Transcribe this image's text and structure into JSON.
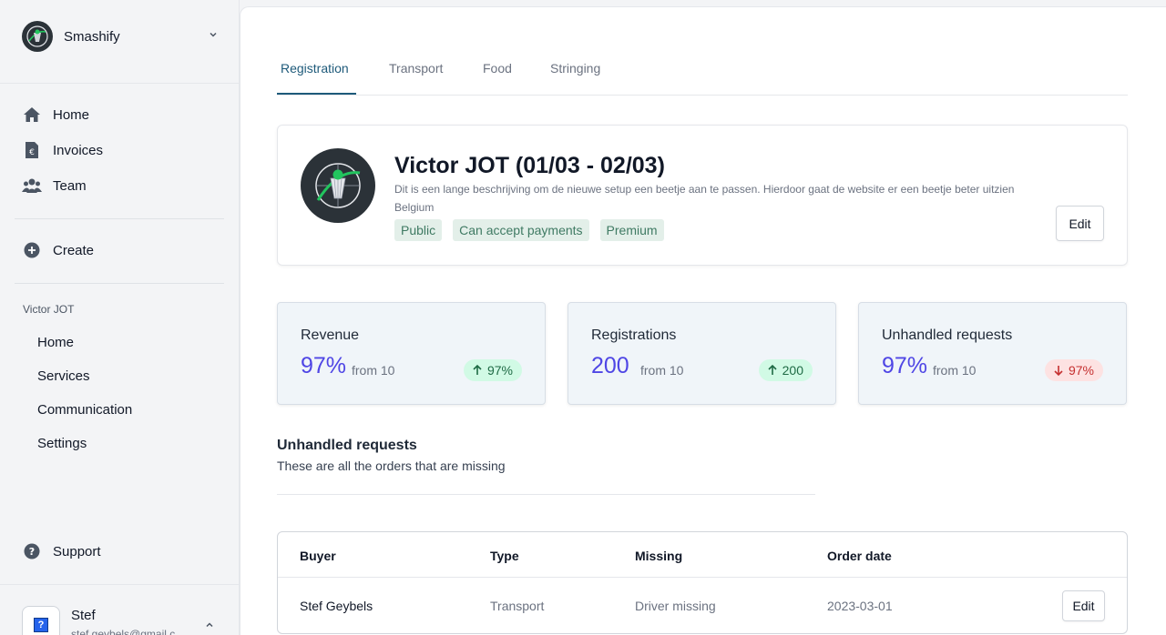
{
  "org": {
    "name": "Smashify"
  },
  "nav": {
    "items": [
      {
        "label": "Home",
        "icon": "home-icon"
      },
      {
        "label": "Invoices",
        "icon": "invoice-icon"
      },
      {
        "label": "Team",
        "icon": "team-icon"
      }
    ],
    "create_label": "Create"
  },
  "event_nav": {
    "section_label": "Victor JOT",
    "items": [
      "Home",
      "Services",
      "Communication",
      "Settings"
    ]
  },
  "support": {
    "label": "Support"
  },
  "user": {
    "name": "Stef",
    "email": "stef.geybels@gmail.c"
  },
  "tabs": [
    "Registration",
    "Transport",
    "Food",
    "Stringing"
  ],
  "event": {
    "title": "Victor JOT (01/03 - 02/03)",
    "description": "Dit is een lange beschrijving om de nieuwe setup een beetje aan te passen. Hierdoor gaat de website er een beetje beter uitzien",
    "country": "Belgium",
    "tags": [
      "Public",
      "Can accept payments",
      "Premium"
    ],
    "edit_label": "Edit"
  },
  "stats": [
    {
      "label": "Revenue",
      "value": "97%",
      "from": "from 10",
      "change": "97%",
      "trend": "up"
    },
    {
      "label": "Registrations",
      "value": "200",
      "from": "from 10",
      "change": "200",
      "trend": "up"
    },
    {
      "label": "Unhandled requests",
      "value": "97%",
      "from": "from 10",
      "change": "97%",
      "trend": "down"
    }
  ],
  "requests": {
    "title": "Unhandled requests",
    "subtitle": "These are all the orders that are missing",
    "columns": [
      "Buyer",
      "Type",
      "Missing",
      "Order date"
    ],
    "rows": [
      {
        "buyer": "Stef Geybels",
        "type": "Transport",
        "missing": "Driver missing",
        "date": "2023-03-01",
        "action": "Edit"
      }
    ]
  },
  "colors": {
    "accent": "#4f46e5",
    "tab_active": "#1e5a7a",
    "tag_bg": "#e3efe9",
    "up": "#1f6b45",
    "down": "#c53030"
  }
}
